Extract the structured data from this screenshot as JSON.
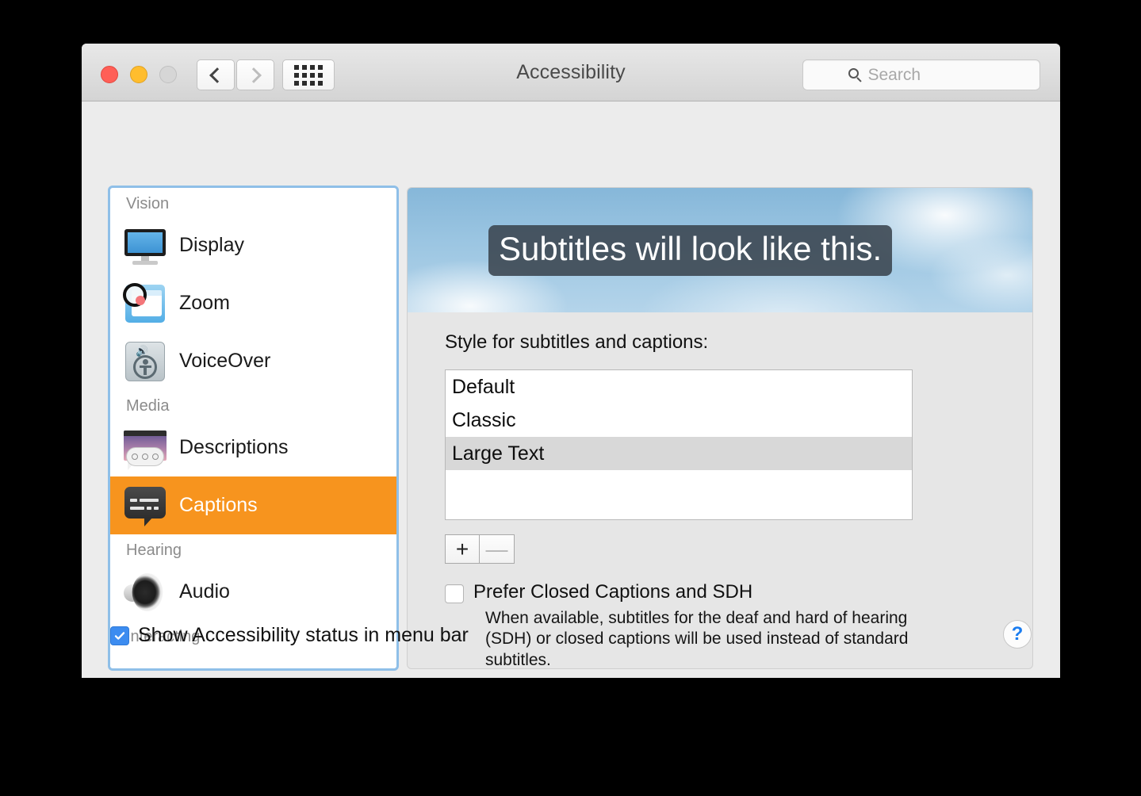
{
  "window": {
    "title": "Accessibility",
    "traffic_lights": [
      "close",
      "minimize",
      "zoom"
    ],
    "colors": {
      "close": "#ff5f57",
      "minimize": "#ffbd2e",
      "zoom_disabled": "#d6d6d6",
      "selection_orange": "#f7941e",
      "focus_ring_blue": "#8fbfe8",
      "checkbox_blue": "#3c8cf0",
      "help_blue": "#1a7cf0"
    }
  },
  "toolbar": {
    "back_label": "Back",
    "forward_label": "Forward",
    "show_all_label": "Show All",
    "search": {
      "placeholder": "Search",
      "value": ""
    }
  },
  "sidebar": {
    "groups": [
      {
        "label": "Vision",
        "items": [
          {
            "label": "Display",
            "icon": "display-icon",
            "selected": false
          },
          {
            "label": "Zoom",
            "icon": "zoom-icon",
            "selected": false
          },
          {
            "label": "VoiceOver",
            "icon": "voiceover-icon",
            "selected": false
          }
        ]
      },
      {
        "label": "Media",
        "items": [
          {
            "label": "Descriptions",
            "icon": "descriptions-icon",
            "selected": false
          },
          {
            "label": "Captions",
            "icon": "captions-icon",
            "selected": true
          }
        ]
      },
      {
        "label": "Hearing",
        "items": [
          {
            "label": "Audio",
            "icon": "audio-icon",
            "selected": false
          }
        ]
      },
      {
        "label": "Interacting",
        "items": []
      }
    ]
  },
  "panel": {
    "preview": {
      "subtitle_text": "Subtitles will look like this."
    },
    "style_label": "Style for subtitles and captions:",
    "styles": [
      {
        "label": "Default",
        "selected": false
      },
      {
        "label": "Classic",
        "selected": false
      },
      {
        "label": "Large Text",
        "selected": true
      }
    ],
    "add_button": "+",
    "remove_button": "—",
    "sdh": {
      "label": "Prefer Closed Captions and SDH",
      "checked": false,
      "description": "When available, subtitles for the deaf and hard of hearing (SDH) or closed captions will be used instead of standard subtitles."
    }
  },
  "footer": {
    "menubar_checkbox_label": "Show Accessibility status in menu bar",
    "menubar_checkbox_checked": true,
    "help_label": "?"
  }
}
